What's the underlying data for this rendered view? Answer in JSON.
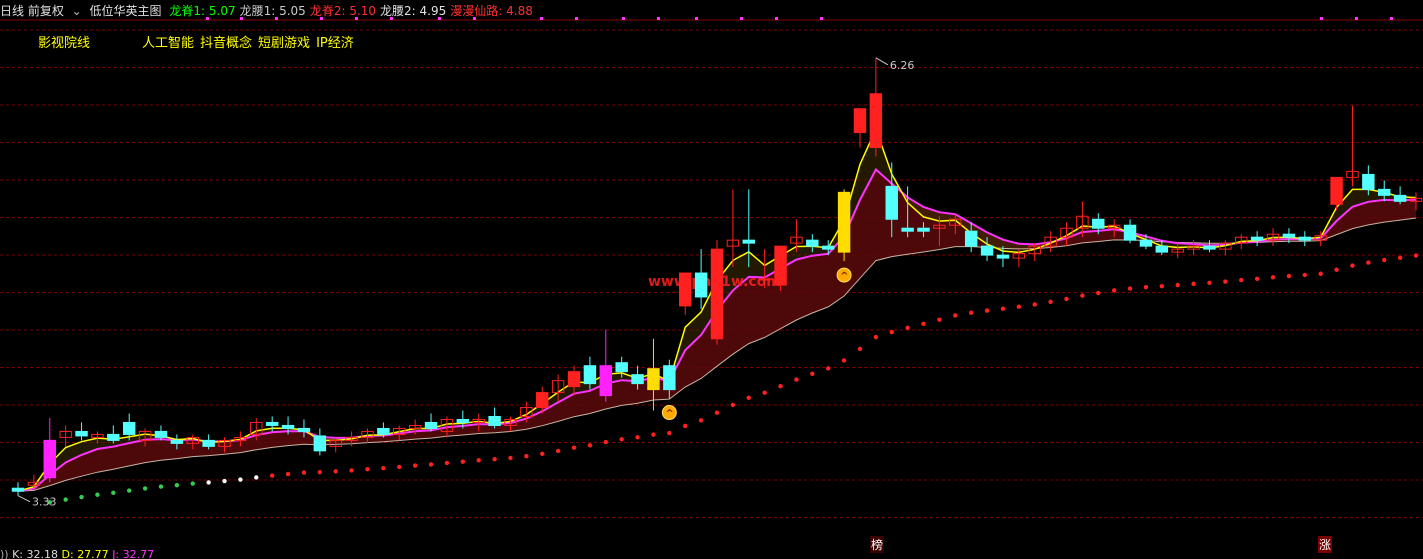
{
  "header": {
    "period": "日线 前复权",
    "icon": "chevron-down-icon",
    "main_title": "低位华英主图",
    "indicators": [
      {
        "label": "龙脊1: 5.07",
        "color": "#00ff00"
      },
      {
        "label": "龙腰1: 5.05",
        "color": "#c8c8c8"
      },
      {
        "label": "龙脊2: 5.10",
        "color": "#ff3030"
      },
      {
        "label": "龙腰2: 4.95",
        "color": "#e0e0e0"
      },
      {
        "label": "漫漫仙路: 4.88",
        "color": "#ff3030"
      }
    ]
  },
  "concepts": [
    "影视院线",
    "人工智能",
    "抖音概念",
    "短剧游戏",
    "IP经济"
  ],
  "watermark": "www.php1w.com",
  "tags": {
    "bang": "榜",
    "zhang": "涨"
  },
  "bottom": {
    "k": "K: 32.18",
    "d": "D: 27.77",
    "j": "J: 32.77"
  },
  "chart_data": {
    "type": "candlestick",
    "ylim": [
      3.0,
      6.5
    ],
    "high_label": "6.26",
    "low_label": "3.33",
    "colors": {
      "up": "#ff2020",
      "down": "#54ffff",
      "limit_up": "#ff22ff",
      "yellow": "#ffdd00",
      "ma_fast": "#ffff00",
      "ma_mid": "#ff33ff",
      "ma_slow": "#c8b4a0",
      "dots": "#ff2020",
      "grid": "#7a0000"
    },
    "candles": [
      {
        "o": 3.38,
        "h": 3.42,
        "l": 3.33,
        "c": 3.36
      },
      {
        "o": 3.4,
        "h": 3.47,
        "l": 3.38,
        "c": 3.42
      },
      {
        "o": 3.45,
        "h": 3.85,
        "l": 3.42,
        "c": 3.7,
        "s": "limit"
      },
      {
        "o": 3.72,
        "h": 3.8,
        "l": 3.66,
        "c": 3.76
      },
      {
        "o": 3.76,
        "h": 3.82,
        "l": 3.7,
        "c": 3.73
      },
      {
        "o": 3.72,
        "h": 3.76,
        "l": 3.68,
        "c": 3.74
      },
      {
        "o": 3.74,
        "h": 3.8,
        "l": 3.68,
        "c": 3.7
      },
      {
        "o": 3.82,
        "h": 3.88,
        "l": 3.7,
        "c": 3.74
      },
      {
        "o": 3.7,
        "h": 3.78,
        "l": 3.66,
        "c": 3.76
      },
      {
        "o": 3.76,
        "h": 3.8,
        "l": 3.7,
        "c": 3.72
      },
      {
        "o": 3.7,
        "h": 3.74,
        "l": 3.64,
        "c": 3.68
      },
      {
        "o": 3.68,
        "h": 3.74,
        "l": 3.64,
        "c": 3.72
      },
      {
        "o": 3.7,
        "h": 3.74,
        "l": 3.64,
        "c": 3.66
      },
      {
        "o": 3.66,
        "h": 3.72,
        "l": 3.62,
        "c": 3.7
      },
      {
        "o": 3.7,
        "h": 3.76,
        "l": 3.66,
        "c": 3.72
      },
      {
        "o": 3.74,
        "h": 3.85,
        "l": 3.7,
        "c": 3.82
      },
      {
        "o": 3.82,
        "h": 3.86,
        "l": 3.76,
        "c": 3.8
      },
      {
        "o": 3.8,
        "h": 3.86,
        "l": 3.74,
        "c": 3.78
      },
      {
        "o": 3.78,
        "h": 3.84,
        "l": 3.72,
        "c": 3.76
      },
      {
        "o": 3.73,
        "h": 3.78,
        "l": 3.6,
        "c": 3.63
      },
      {
        "o": 3.66,
        "h": 3.72,
        "l": 3.62,
        "c": 3.7
      },
      {
        "o": 3.7,
        "h": 3.76,
        "l": 3.66,
        "c": 3.72
      },
      {
        "o": 3.72,
        "h": 3.78,
        "l": 3.68,
        "c": 3.76
      },
      {
        "o": 3.78,
        "h": 3.82,
        "l": 3.72,
        "c": 3.74
      },
      {
        "o": 3.74,
        "h": 3.8,
        "l": 3.7,
        "c": 3.78
      },
      {
        "o": 3.78,
        "h": 3.84,
        "l": 3.74,
        "c": 3.8
      },
      {
        "o": 3.82,
        "h": 3.88,
        "l": 3.76,
        "c": 3.78
      },
      {
        "o": 3.76,
        "h": 3.86,
        "l": 3.72,
        "c": 3.84
      },
      {
        "o": 3.84,
        "h": 3.9,
        "l": 3.78,
        "c": 3.82
      },
      {
        "o": 3.82,
        "h": 3.88,
        "l": 3.76,
        "c": 3.84
      },
      {
        "o": 3.86,
        "h": 3.92,
        "l": 3.78,
        "c": 3.8
      },
      {
        "o": 3.8,
        "h": 3.86,
        "l": 3.76,
        "c": 3.84
      },
      {
        "o": 3.86,
        "h": 3.96,
        "l": 3.82,
        "c": 3.92
      },
      {
        "o": 3.92,
        "h": 4.06,
        "l": 3.88,
        "c": 4.02
      },
      {
        "o": 4.02,
        "h": 4.14,
        "l": 3.96,
        "c": 4.1
      },
      {
        "o": 4.06,
        "h": 4.2,
        "l": 4.0,
        "c": 4.16
      },
      {
        "o": 4.2,
        "h": 4.26,
        "l": 4.04,
        "c": 4.08
      },
      {
        "o": 4.0,
        "h": 4.44,
        "l": 3.96,
        "c": 4.2,
        "s": "limit"
      },
      {
        "o": 4.22,
        "h": 4.26,
        "l": 4.12,
        "c": 4.16
      },
      {
        "o": 4.14,
        "h": 4.2,
        "l": 4.04,
        "c": 4.08
      },
      {
        "o": 4.04,
        "h": 4.38,
        "l": 3.9,
        "c": 4.18,
        "s": "yellow"
      },
      {
        "o": 4.2,
        "h": 4.24,
        "l": 3.98,
        "c": 4.04
      },
      {
        "o": 4.6,
        "h": 4.82,
        "l": 4.54,
        "c": 4.82
      },
      {
        "o": 4.82,
        "h": 4.98,
        "l": 4.58,
        "c": 4.66
      },
      {
        "o": 4.38,
        "h": 5.04,
        "l": 4.34,
        "c": 4.98
      },
      {
        "o": 5.0,
        "h": 5.38,
        "l": 4.86,
        "c": 5.04
      },
      {
        "o": 5.04,
        "h": 5.38,
        "l": 4.86,
        "c": 5.02
      },
      {
        "o": 4.78,
        "h": 4.98,
        "l": 4.72,
        "c": 4.78
      },
      {
        "o": 4.74,
        "h": 4.9,
        "l": 4.7,
        "c": 5.0
      },
      {
        "o": 5.02,
        "h": 5.18,
        "l": 4.96,
        "c": 5.06
      },
      {
        "o": 5.04,
        "h": 5.08,
        "l": 4.96,
        "c": 5.0
      },
      {
        "o": 5.0,
        "h": 5.04,
        "l": 4.94,
        "c": 4.98
      },
      {
        "o": 4.96,
        "h": 5.38,
        "l": 4.9,
        "c": 5.36,
        "s": "yellow"
      },
      {
        "o": 5.76,
        "h": 5.92,
        "l": 5.66,
        "c": 5.92
      },
      {
        "o": 5.66,
        "h": 6.26,
        "l": 5.6,
        "c": 6.02
      },
      {
        "o": 5.4,
        "h": 5.56,
        "l": 5.06,
        "c": 5.18
      },
      {
        "o": 5.12,
        "h": 5.4,
        "l": 5.06,
        "c": 5.1
      },
      {
        "o": 5.12,
        "h": 5.16,
        "l": 5.06,
        "c": 5.1
      },
      {
        "o": 5.12,
        "h": 5.2,
        "l": 5.0,
        "c": 5.14
      },
      {
        "o": 5.14,
        "h": 5.22,
        "l": 5.08,
        "c": 5.18
      },
      {
        "o": 5.1,
        "h": 5.16,
        "l": 4.96,
        "c": 5.0
      },
      {
        "o": 5.0,
        "h": 5.06,
        "l": 4.9,
        "c": 4.94
      },
      {
        "o": 4.94,
        "h": 5.0,
        "l": 4.86,
        "c": 4.92
      },
      {
        "o": 4.92,
        "h": 4.98,
        "l": 4.86,
        "c": 4.95
      },
      {
        "o": 4.95,
        "h": 5.02,
        "l": 4.9,
        "c": 5.0
      },
      {
        "o": 5.0,
        "h": 5.1,
        "l": 4.96,
        "c": 5.06
      },
      {
        "o": 5.06,
        "h": 5.16,
        "l": 5.0,
        "c": 5.12
      },
      {
        "o": 5.12,
        "h": 5.3,
        "l": 5.06,
        "c": 5.2
      },
      {
        "o": 5.18,
        "h": 5.22,
        "l": 5.08,
        "c": 5.12
      },
      {
        "o": 5.12,
        "h": 5.18,
        "l": 5.06,
        "c": 5.14
      },
      {
        "o": 5.14,
        "h": 5.18,
        "l": 5.02,
        "c": 5.04
      },
      {
        "o": 5.04,
        "h": 5.08,
        "l": 4.98,
        "c": 5.0
      },
      {
        "o": 5.0,
        "h": 5.04,
        "l": 4.94,
        "c": 4.96
      },
      {
        "o": 4.96,
        "h": 5.02,
        "l": 4.92,
        "c": 4.98
      },
      {
        "o": 4.98,
        "h": 5.04,
        "l": 4.94,
        "c": 5.0
      },
      {
        "o": 5.0,
        "h": 5.04,
        "l": 4.96,
        "c": 4.98
      },
      {
        "o": 4.98,
        "h": 5.04,
        "l": 4.94,
        "c": 5.02
      },
      {
        "o": 5.02,
        "h": 5.08,
        "l": 4.98,
        "c": 5.06
      },
      {
        "o": 5.06,
        "h": 5.1,
        "l": 5.0,
        "c": 5.04
      },
      {
        "o": 5.04,
        "h": 5.12,
        "l": 5.0,
        "c": 5.08
      },
      {
        "o": 5.08,
        "h": 5.12,
        "l": 5.02,
        "c": 5.06
      },
      {
        "o": 5.06,
        "h": 5.1,
        "l": 5.0,
        "c": 5.04
      },
      {
        "o": 5.04,
        "h": 5.1,
        "l": 5.0,
        "c": 5.07
      },
      {
        "o": 5.28,
        "h": 5.46,
        "l": 5.24,
        "c": 5.46
      },
      {
        "o": 5.46,
        "h": 5.94,
        "l": 5.4,
        "c": 5.5
      },
      {
        "o": 5.48,
        "h": 5.54,
        "l": 5.34,
        "c": 5.38
      },
      {
        "o": 5.38,
        "h": 5.44,
        "l": 5.3,
        "c": 5.34
      },
      {
        "o": 5.34,
        "h": 5.4,
        "l": 5.28,
        "c": 5.3
      },
      {
        "o": 5.3,
        "h": 5.36,
        "l": 5.24,
        "c": 5.32
      }
    ]
  }
}
